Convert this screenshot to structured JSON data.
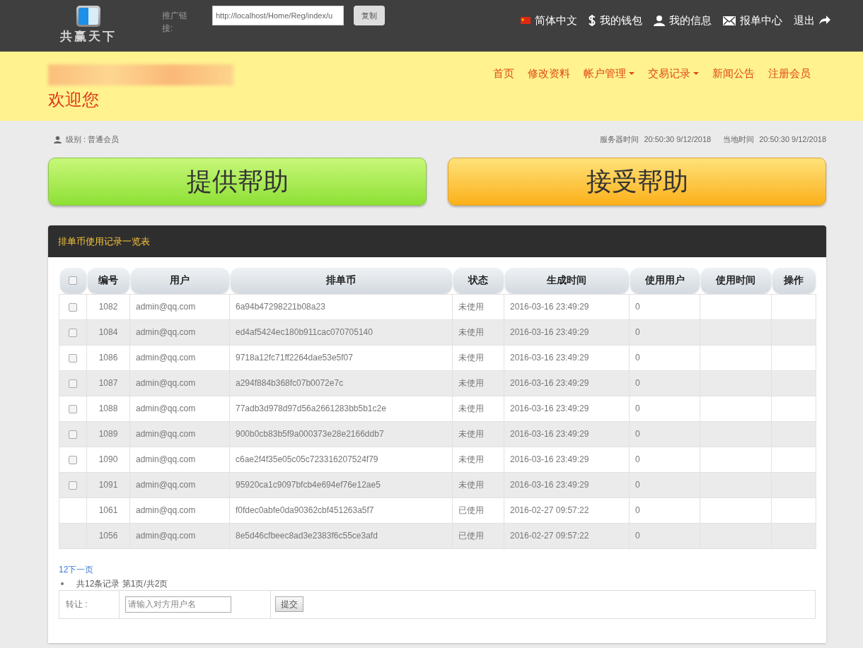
{
  "header": {
    "logo_text": "共赢天下",
    "promo_label": "推广链接:",
    "promo_link": "http://localhost/Home/Reg/index/u",
    "copy_button": "复制",
    "links": [
      {
        "kind": "flag",
        "label": "简体中文"
      },
      {
        "kind": "dollar",
        "label": "我的钱包"
      },
      {
        "kind": "user",
        "label": "我的信息"
      },
      {
        "kind": "mail",
        "label": "报单中心"
      },
      {
        "kind": "logout",
        "label": "退出"
      }
    ]
  },
  "banner": {
    "welcome": "欢迎您",
    "nav": [
      {
        "label": "首页",
        "dropdown": false
      },
      {
        "label": "修改资料",
        "dropdown": false
      },
      {
        "label": "帐户管理",
        "dropdown": true
      },
      {
        "label": "交易记录",
        "dropdown": true
      },
      {
        "label": "新闻公告",
        "dropdown": false
      },
      {
        "label": "注册会员",
        "dropdown": false
      }
    ]
  },
  "info": {
    "level": "级别 : 普通会员",
    "server_time_label": "服务器时间",
    "server_time": "20:50:30 9/12/2018",
    "local_time_label": "当地时间",
    "local_time": "20:50:30 9/12/2018"
  },
  "actions": [
    {
      "kind": "green",
      "label": "提供帮助"
    },
    {
      "kind": "orange",
      "label": "接受帮助"
    }
  ],
  "panel": {
    "title": "排单币使用记录一览表",
    "columns": [
      "编号",
      "用户",
      "排单币",
      "状态",
      "生成时间",
      "使用用户",
      "使用时间",
      "操作"
    ],
    "header_checkbox": {
      "checked": false
    },
    "rows": [
      {
        "kind": "checkbox",
        "checked": false,
        "cells": [
          "1082",
          "admin@qq.com",
          "6a94b47298221b08a23",
          "未使用",
          "2016-03-16 23:49:29",
          "0"
        ]
      },
      {
        "kind": "checkbox",
        "checked": false,
        "cells": [
          "1084",
          "admin@qq.com",
          "ed4af5424ec180b911cac070705140",
          "未使用",
          "2016-03-16 23:49:29",
          "0"
        ]
      },
      {
        "kind": "checkbox",
        "checked": false,
        "cells": [
          "1086",
          "admin@qq.com",
          "9718a12fc71ff2264dae53e5f07",
          "未使用",
          "2016-03-16 23:49:29",
          "0"
        ]
      },
      {
        "kind": "checkbox",
        "checked": false,
        "cells": [
          "1087",
          "admin@qq.com",
          "a294f884b368fc07b0072e7c",
          "未使用",
          "2016-03-16 23:49:29",
          "0"
        ]
      },
      {
        "kind": "checkbox",
        "checked": false,
        "cells": [
          "1088",
          "admin@qq.com",
          "77adb3d978d97d56a2661283bb5b1c2e",
          "未使用",
          "2016-03-16 23:49:29",
          "0"
        ]
      },
      {
        "kind": "checkbox",
        "checked": false,
        "cells": [
          "1089",
          "admin@qq.com",
          "900b0cb83b5f9a000373e28e2166ddb7",
          "未使用",
          "2016-03-16 23:49:29",
          "0"
        ]
      },
      {
        "kind": "checkbox",
        "checked": false,
        "cells": [
          "1090",
          "admin@qq.com",
          "c6ae2f4f35e05c05c723316207524f79",
          "未使用",
          "2016-03-16 23:49:29",
          "0"
        ]
      },
      {
        "kind": "checkbox",
        "checked": false,
        "cells": [
          "1091",
          "admin@qq.com",
          "95920ca1c9097bfcb4e694ef76e12ae5",
          "未使用",
          "2016-03-16 23:49:29",
          "0"
        ]
      },
      {
        "kind": "plain",
        "cells": [
          "1061",
          "admin@qq.com",
          "f0fdec0abfe0da90362cbf451263a5f7",
          "已使用",
          "2016-02-27 09:57:22",
          "0"
        ]
      },
      {
        "kind": "plain",
        "cells": [
          "1056",
          "admin@qq.com",
          "8e5d46cfbeec8ad3e2383f6c55ce3afd",
          "已使用",
          "2016-02-27 09:57:22",
          "0"
        ]
      }
    ],
    "pager_link": "12下一页",
    "pager_info": "共12条记录 第1页/共2页",
    "transfer": {
      "label": "转让 :",
      "placeholder": "请输入对方用户名",
      "submit": "提交"
    }
  }
}
